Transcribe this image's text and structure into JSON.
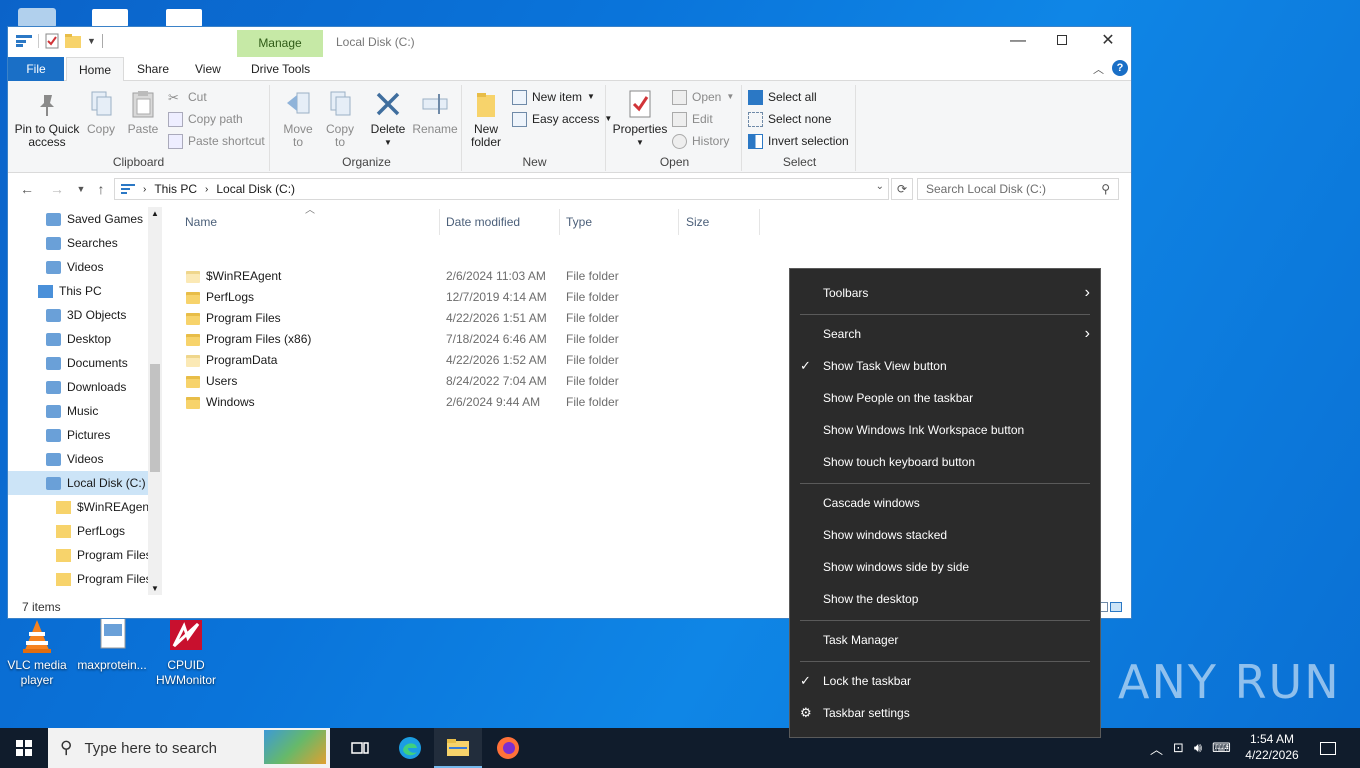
{
  "desktop": {
    "icons": [
      {
        "label_line1": "VLC media",
        "label_line2": "player"
      },
      {
        "label_line1": "maxprotein...",
        "label_line2": ""
      },
      {
        "label_line1": "CPUID",
        "label_line2": "HWMonitor"
      }
    ],
    "watermark": "ANY RUN"
  },
  "window": {
    "title": "Local Disk (C:)",
    "manage_tab": "Manage",
    "tabs": {
      "file": "File",
      "home": "Home",
      "share": "Share",
      "view": "View",
      "drive_tools": "Drive Tools"
    },
    "ribbon": {
      "clipboard": {
        "label": "Clipboard",
        "pin_line1": "Pin to Quick",
        "pin_line2": "access",
        "copy": "Copy",
        "paste": "Paste",
        "cut": "Cut",
        "copy_path": "Copy path",
        "paste_shortcut": "Paste shortcut"
      },
      "organize": {
        "label": "Organize",
        "move_line1": "Move",
        "move_line2": "to",
        "copy_line1": "Copy",
        "copy_line2": "to",
        "delete": "Delete",
        "rename": "Rename"
      },
      "new": {
        "label": "New",
        "new_folder_line1": "New",
        "new_folder_line2": "folder",
        "new_item": "New item",
        "easy_access": "Easy access"
      },
      "open": {
        "label": "Open",
        "properties": "Properties",
        "open": "Open",
        "edit": "Edit",
        "history": "History"
      },
      "select": {
        "label": "Select",
        "select_all": "Select all",
        "select_none": "Select none",
        "invert": "Invert selection"
      }
    },
    "address": {
      "crumb1": "This PC",
      "crumb2": "Local Disk (C:)",
      "search_placeholder": "Search Local Disk (C:)"
    },
    "nav": [
      {
        "label": "Saved Games",
        "indent": 2,
        "sel": false
      },
      {
        "label": "Searches",
        "indent": 2,
        "sel": false
      },
      {
        "label": "Videos",
        "indent": 2,
        "sel": false
      },
      {
        "label": "This PC",
        "indent": 1,
        "sel": false
      },
      {
        "label": "3D Objects",
        "indent": 2,
        "sel": false
      },
      {
        "label": "Desktop",
        "indent": 2,
        "sel": false
      },
      {
        "label": "Documents",
        "indent": 2,
        "sel": false
      },
      {
        "label": "Downloads",
        "indent": 2,
        "sel": false
      },
      {
        "label": "Music",
        "indent": 2,
        "sel": false
      },
      {
        "label": "Pictures",
        "indent": 2,
        "sel": false
      },
      {
        "label": "Videos",
        "indent": 2,
        "sel": false
      },
      {
        "label": "Local Disk (C:)",
        "indent": 2,
        "sel": true
      },
      {
        "label": "$WinREAgent",
        "indent": 3,
        "sel": false
      },
      {
        "label": "PerfLogs",
        "indent": 3,
        "sel": false
      },
      {
        "label": "Program Files",
        "indent": 3,
        "sel": false
      },
      {
        "label": "Program Files",
        "indent": 3,
        "sel": false
      }
    ],
    "columns": {
      "name": "Name",
      "date": "Date modified",
      "type": "Type",
      "size": "Size"
    },
    "files": [
      {
        "name": "$WinREAgent",
        "date": "2/6/2024 11:03 AM",
        "type": "File folder",
        "light": true
      },
      {
        "name": "PerfLogs",
        "date": "12/7/2019 4:14 AM",
        "type": "File folder",
        "light": false
      },
      {
        "name": "Program Files",
        "date": "4/22/2026 1:51 AM",
        "type": "File folder",
        "light": false
      },
      {
        "name": "Program Files (x86)",
        "date": "7/18/2024 6:46 AM",
        "type": "File folder",
        "light": false
      },
      {
        "name": "ProgramData",
        "date": "4/22/2026 1:52 AM",
        "type": "File folder",
        "light": true
      },
      {
        "name": "Users",
        "date": "8/24/2022 7:04 AM",
        "type": "File folder",
        "light": false
      },
      {
        "name": "Windows",
        "date": "2/6/2024 9:44 AM",
        "type": "File folder",
        "light": false
      }
    ],
    "status": "7 items"
  },
  "context_menu": {
    "toolbars": "Toolbars",
    "search": "Search",
    "task_view": "Show Task View button",
    "people": "Show People on the taskbar",
    "ink": "Show Windows Ink Workspace button",
    "touch_kb": "Show touch keyboard button",
    "cascade": "Cascade windows",
    "stacked": "Show windows stacked",
    "side_by_side": "Show windows side by side",
    "show_desktop": "Show the desktop",
    "task_manager": "Task Manager",
    "lock": "Lock the taskbar",
    "settings": "Taskbar settings"
  },
  "taskbar": {
    "search_placeholder": "Type here to search",
    "time": "1:54 AM",
    "date": "4/22/2026"
  }
}
